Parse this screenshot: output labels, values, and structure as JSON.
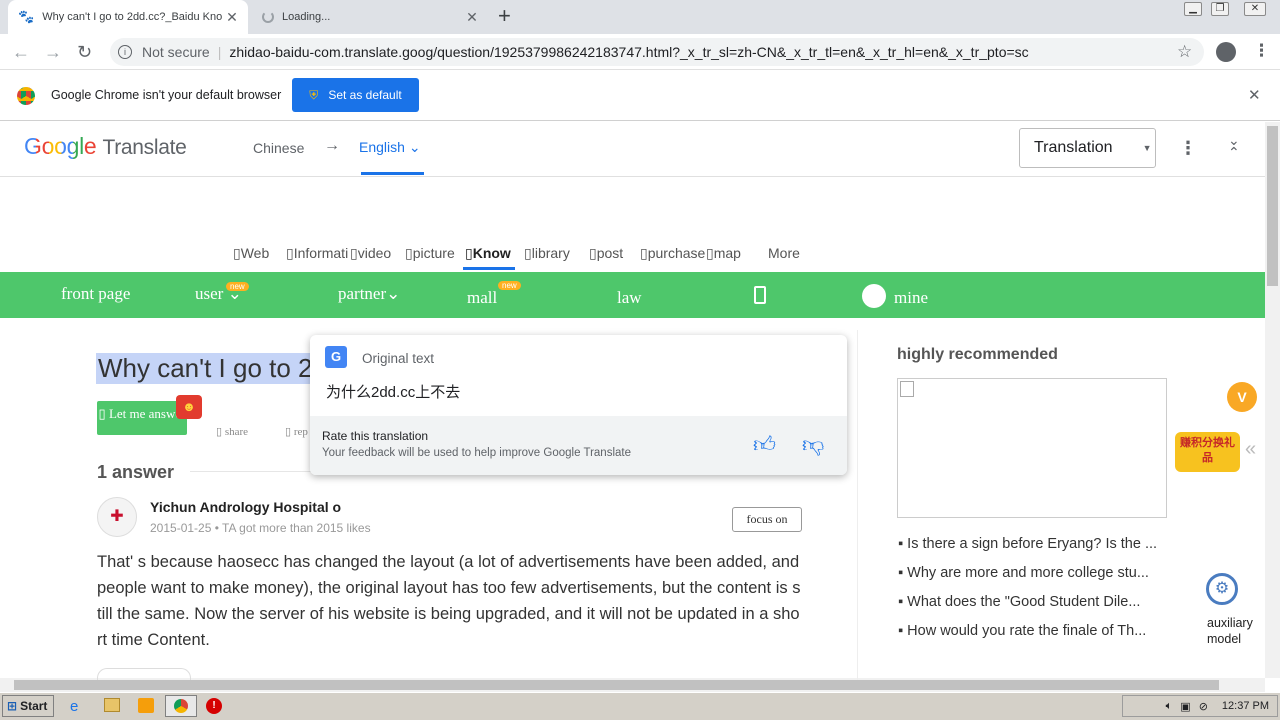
{
  "tabs": [
    {
      "title": "Why can't I go to 2dd.cc?_Baidu Kno",
      "close": "✕"
    },
    {
      "title": "Loading...",
      "close": "✕"
    }
  ],
  "newtab": "+",
  "address": {
    "security": "Not secure",
    "url": "zhidao-baidu-com.translate.goog/question/1925379986242183747.html?_x_tr_sl=zh-CN&_x_tr_tl=en&_x_tr_hl=en&_x_tr_pto=sc"
  },
  "infobar": {
    "message": "Google Chrome isn't your default browser",
    "button": "Set as default",
    "close": "✕"
  },
  "translate": {
    "brand": "Google",
    "product": "Translate",
    "from": "Chinese",
    "arrow": "→",
    "to": "English",
    "mode": "Translation"
  },
  "search_nav": [
    "Web",
    "Informati",
    "video",
    "picture",
    "Know",
    "library",
    "post",
    "purchase",
    "map",
    "More"
  ],
  "green_nav": {
    "front": "front page",
    "user": "user",
    "partner": "partner",
    "mall": "mall",
    "law": "law",
    "mine": "mine",
    "badge": "new"
  },
  "question": {
    "title": "Why can't I go to 2",
    "letme": "Let me answer",
    "share": "share",
    "report": "rep"
  },
  "popup": {
    "original_label": "Original text",
    "original": "为什么2dd.cc上不去",
    "rate_title": "Rate this translation",
    "rate_sub": "Your feedback will be used to help improve Google Translate"
  },
  "answers": {
    "count": "1 answer",
    "author": "Yichun Andrology Hospital o",
    "meta": "2015-01-25 • TA got more than 2015 likes",
    "focus": "focus on",
    "text": "That' s because haosecc has changed the layout (a lot of advertisements have been added, and people want to make money), the original layout has too few advertisements, but the content is still the same. Now the server of his website is being upgraded, and it will not be updated in a short time Content."
  },
  "sidebar": {
    "title": "highly recommended",
    "items": [
      "Is there a sign before Eryang? Is the ...",
      "Why are more and more college stu...",
      "What does the \"Good Student Dile...",
      "How would you rate the finale of Th..."
    ],
    "aux": "auxiliary model",
    "promo": "赚积分换礼品"
  },
  "taskbar": {
    "start": "Start",
    "time": "12:37 PM"
  },
  "colors": {
    "green": "#4ec76b",
    "blue": "#1a73e8"
  }
}
